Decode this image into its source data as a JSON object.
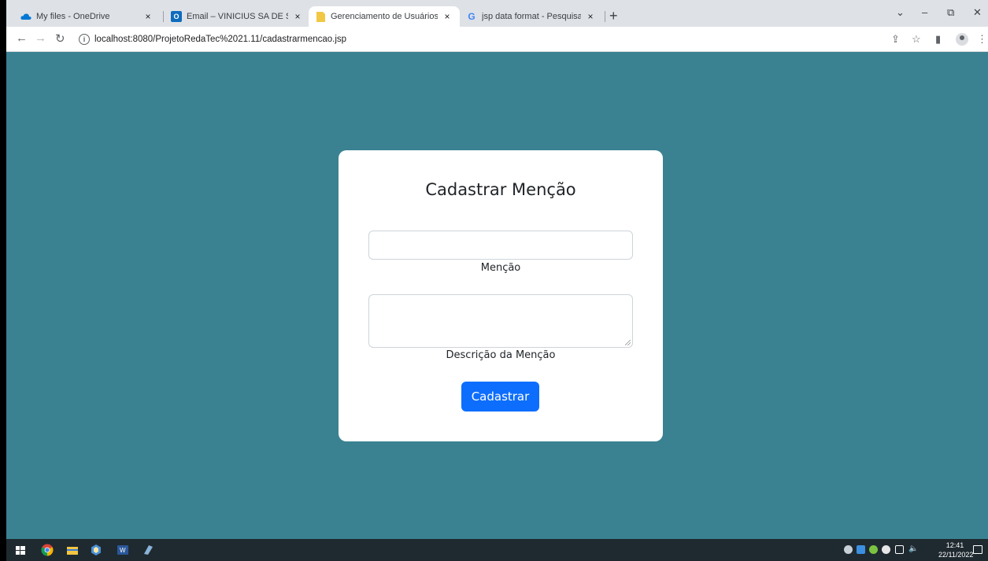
{
  "browser": {
    "tabs": [
      {
        "title": "My files - OneDrive",
        "icon": "onedrive-icon",
        "color": "#0078d4"
      },
      {
        "title": "Email – VINICIUS SA DE SOUZA - ",
        "icon": "outlook-icon",
        "color": "#0f6cbd",
        "glyph": "O"
      },
      {
        "title": "Gerenciamento de Usuários",
        "icon": "document-icon",
        "color": "#f2c744",
        "active": true
      },
      {
        "title": "jsp data format - Pesquisa Googl",
        "icon": "google-icon",
        "color": "#4285f4",
        "glyph": "G"
      }
    ],
    "close_glyph": "×",
    "new_tab_glyph": "+",
    "url": "localhost:8080/ProjetoRedaTec%2021.11/cadastrarmencao.jsp",
    "info_glyph": "i"
  },
  "page": {
    "title": "Cadastrar Menção",
    "mencao_label": "Menção",
    "mencao_value": "",
    "descricao_label": "Descrição da Menção",
    "descricao_value": "",
    "submit_label": "Cadastrar",
    "background_color": "#3a8291",
    "button_color": "#0d6efd"
  },
  "taskbar": {
    "time": "12:41",
    "date": "22/11/2022"
  }
}
